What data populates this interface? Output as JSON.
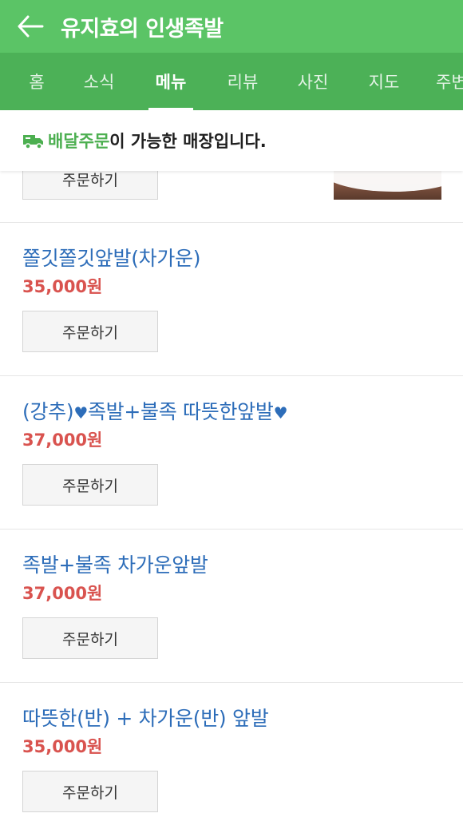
{
  "header": {
    "title": "유지효의 인생족발"
  },
  "tabs": [
    {
      "label": "홈"
    },
    {
      "label": "소식"
    },
    {
      "label": "메뉴"
    },
    {
      "label": "리뷰"
    },
    {
      "label": "사진"
    },
    {
      "label": "지도"
    },
    {
      "label": "주변"
    }
  ],
  "notice": {
    "highlight": "배달주문",
    "text": "이 가능한 매장입니다."
  },
  "menu": {
    "order_label": "주문하기",
    "items": [
      {
        "name": "쫄깃쫄깃앞발(차가운)",
        "price": "35,000원"
      },
      {
        "name_prefix": "(강추)",
        "heart": "♥",
        "name_middle": "족발+불족 따뜻한앞발",
        "price": "37,000원"
      },
      {
        "name": "족발+불족 차가운앞발",
        "price": "37,000원"
      },
      {
        "name": "따뜻한(반) + 차가운(반) 앞발",
        "price": "35,000원"
      }
    ]
  },
  "colors": {
    "header_bg": "#5bc466",
    "tab_bg": "#4cb157",
    "item_name": "#2d6db9",
    "price": "#d9534f",
    "notice_highlight": "#4caf50"
  }
}
